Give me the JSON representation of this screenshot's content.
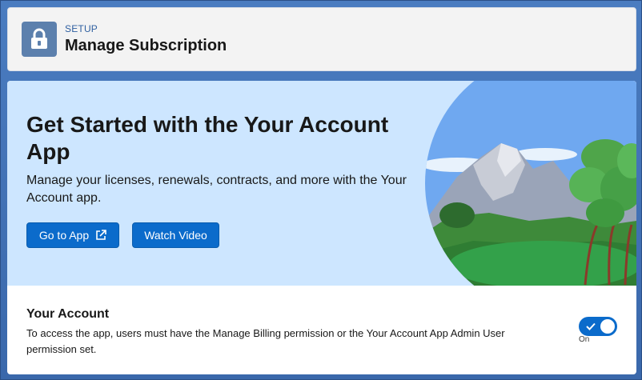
{
  "header": {
    "eyebrow": "SETUP",
    "title": "Manage Subscription",
    "icon": "lock-icon"
  },
  "hero": {
    "title": "Get Started with the Your Account App",
    "description": "Manage your licenses, renewals, contracts, and more with the Your Account app.",
    "go_button": "Go to App",
    "go_button_icon": "external-link-icon",
    "video_button": "Watch Video"
  },
  "section": {
    "title": "Your Account",
    "description": "To access the app, users must have the Manage Billing permission or the Your Account App Admin User permission set.",
    "toggle_label": "On",
    "toggle_on": true
  },
  "colors": {
    "brand": "#0b6bcb",
    "hero_bg": "#cde6ff",
    "header_icon_bg": "#5c80ad",
    "page_bg": "#3f6fb3"
  }
}
